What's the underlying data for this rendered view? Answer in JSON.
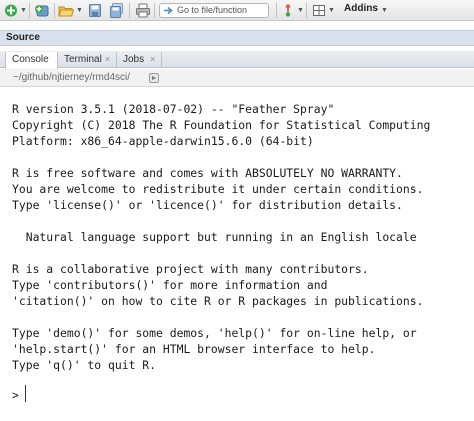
{
  "toolbar": {
    "goto_placeholder": "Go to file/function",
    "addins_label": "Addins"
  },
  "source_panel": {
    "title": "Source"
  },
  "tabs": [
    {
      "label": "Console",
      "active": true,
      "closable": false
    },
    {
      "label": "Terminal",
      "closable": true
    },
    {
      "label": "Jobs",
      "closable": true
    }
  ],
  "tab_close_glyph": "×",
  "path_bar": {
    "path": "~/github/njtierney/rmd4sci/"
  },
  "console": {
    "lines": [
      "R version 3.5.1 (2018-07-02) -- \"Feather Spray\"",
      "Copyright (C) 2018 The R Foundation for Statistical Computing",
      "Platform: x86_64-apple-darwin15.6.0 (64-bit)",
      "",
      "R is free software and comes with ABSOLUTELY NO WARRANTY.",
      "You are welcome to redistribute it under certain conditions.",
      "Type 'license()' or 'licence()' for distribution details.",
      "",
      "  Natural language support but running in an English locale",
      "",
      "R is a collaborative project with many contributors.",
      "Type 'contributors()' for more information and",
      "'citation()' on how to cite R or R packages in publications.",
      "",
      "Type 'demo()' for some demos, 'help()' for on-line help, or",
      "'help.start()' for an HTML browser interface to help.",
      "Type 'q()' to quit R."
    ],
    "prompt": ">"
  },
  "colors": {
    "accent_green": "#3aa84a",
    "toolbar_bg": "#eaeaea",
    "source_bar_bg": "#d9e2ec"
  }
}
